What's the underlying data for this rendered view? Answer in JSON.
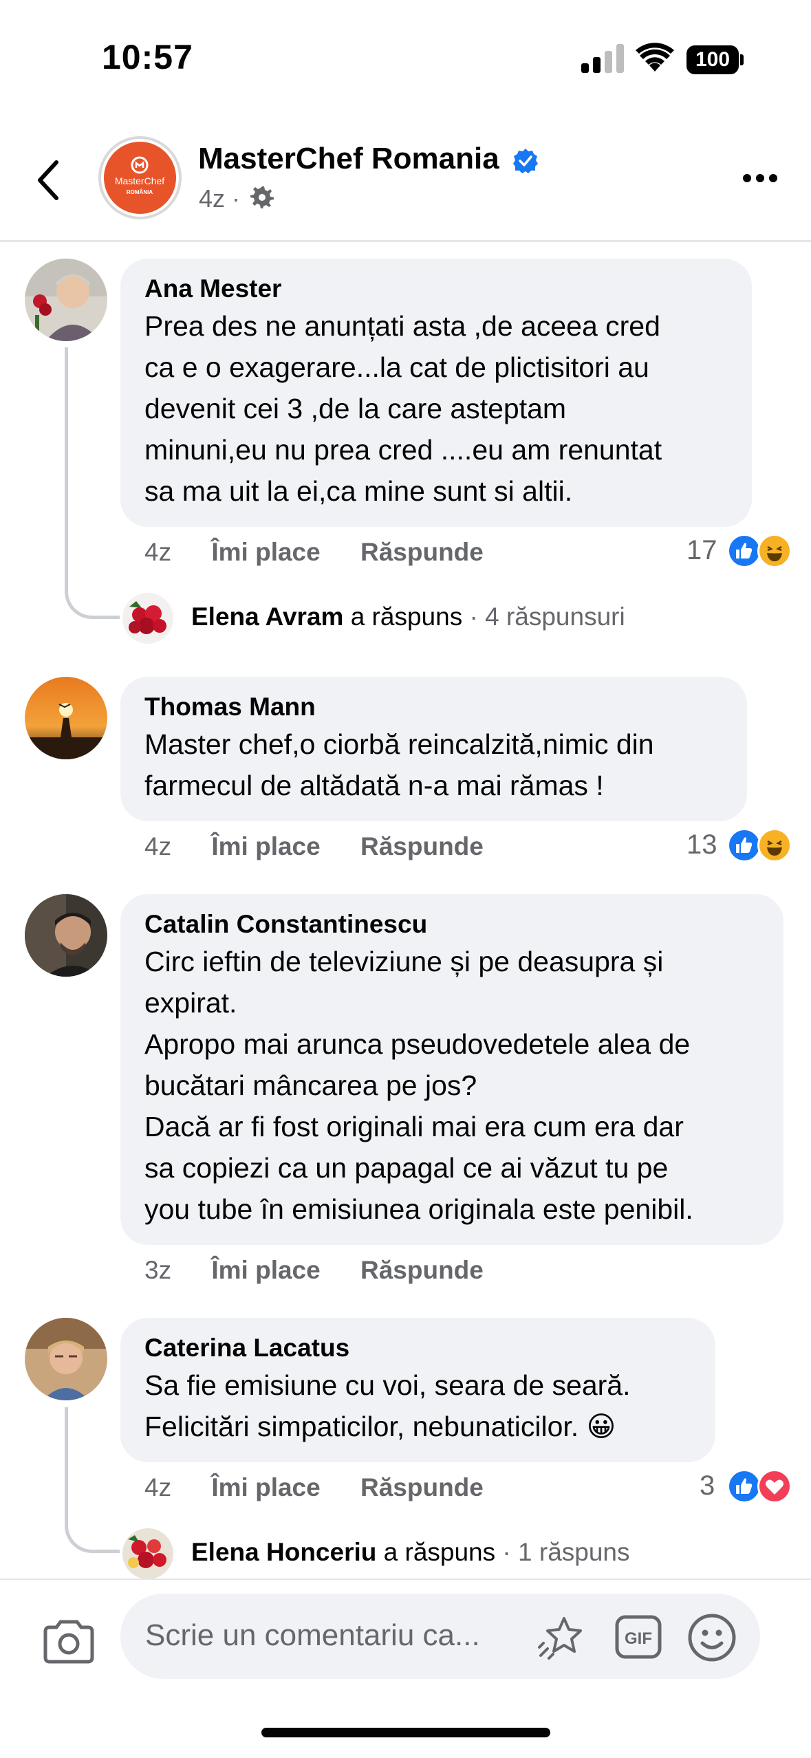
{
  "status_bar": {
    "time": "10:57",
    "battery": "100"
  },
  "header": {
    "page_name": "MasterChef Romania",
    "age": "4z",
    "separator": "·",
    "logo_text_top": "MasterChef",
    "logo_text_bottom": "ROMÂNIA"
  },
  "labels": {
    "like": "Îmi place",
    "reply": "Răspunde",
    "replied": "a răspuns"
  },
  "comments": [
    {
      "author": "Ana Mester",
      "text": "Prea des ne  anunțati asta ,de aceea cred\nca e o exagerare...la cat de plictisitori au\ndevenit cei 3 ,de la care asteptam\nminuni,eu nu prea cred ....eu am renuntat\nsa ma uit la ei,ca mine sunt si altii.",
      "age": "4z",
      "reactions_count": "17",
      "reactions": [
        "like-icon",
        "haha-icon"
      ],
      "reply": {
        "name": "Elena Avram",
        "count": "· 4 răspunsuri"
      }
    },
    {
      "author": "Thomas Mann",
      "text": "Master chef,o ciorbă reincalzită,nimic din\nfarmecul de altădată n-a mai rămas  !",
      "age": "4z",
      "reactions_count": "13",
      "reactions": [
        "like-icon",
        "haha-icon"
      ]
    },
    {
      "author": "Catalin Constantinescu",
      "text": "Circ ieftin de televiziune și pe deasupra și\nexpirat.\nApropo mai arunca pseudovedetele alea de\nbucătari  mâncarea pe jos?\nDacă ar fi fost originali mai era cum era dar\nsa copiezi ca un papagal ce ai văzut tu pe\nyou tube în emisiunea originala este penibil.",
      "age": "3z"
    },
    {
      "author": "Caterina Lacatus",
      "text": "Sa fie emisiune cu voi, seara de seară.\nFelicitări simpaticilor, nebunaticilor. 😀",
      "age": "4z",
      "reactions_count": "3",
      "reactions": [
        "like-icon",
        "love-icon"
      ],
      "reply": {
        "name": "Elena Honceriu",
        "count": "· 1 răspuns"
      }
    }
  ],
  "composer": {
    "placeholder": "Scrie un comentariu ca..."
  },
  "colors": {
    "accent": "#1877f2",
    "bubble": "#f0f2f5",
    "muted": "#65676b",
    "brand": "#e8542a"
  }
}
